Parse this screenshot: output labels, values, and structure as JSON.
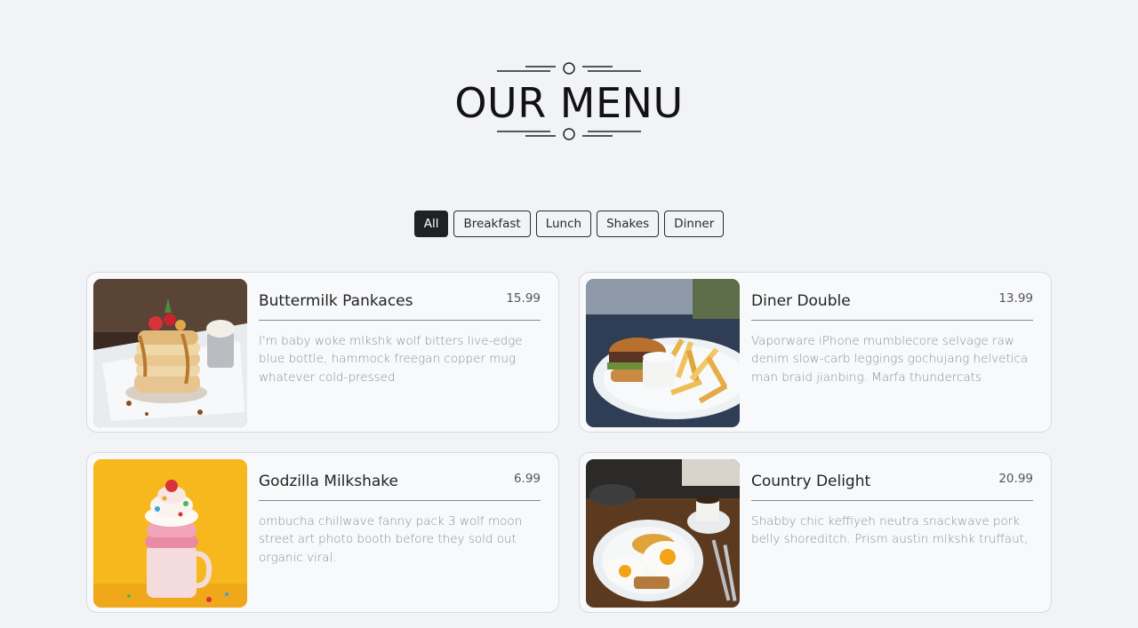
{
  "header": {
    "title": "OUR MENU"
  },
  "filters": {
    "items": [
      {
        "label": "All",
        "active": true
      },
      {
        "label": "Breakfast",
        "active": false
      },
      {
        "label": "Lunch",
        "active": false
      },
      {
        "label": "Shakes",
        "active": false
      },
      {
        "label": "Dinner",
        "active": false
      }
    ]
  },
  "menu": {
    "items": [
      {
        "title": "Buttermilk Pankaces",
        "price": "15.99",
        "description": "I'm baby woke mlkshk wolf bitters live-edge blue bottle, hammock freegan copper mug whatever cold-pressed",
        "image": "pancake-stack-photo"
      },
      {
        "title": "Diner Double",
        "price": "13.99",
        "description": "Vaporware iPhone mumblecore selvage raw denim slow-carb leggings gochujang helvetica man braid jianbing. Marfa thundercats",
        "image": "burger-and-fries-photo"
      },
      {
        "title": "Godzilla Milkshake",
        "price": "6.99",
        "description": "ombucha chillwave fanny pack 3 wolf moon street art photo booth before they sold out organic viral.",
        "image": "milkshake-photo"
      },
      {
        "title": "Country Delight",
        "price": "20.99",
        "description": "Shabby chic keffiyeh neutra snackwave pork belly shoreditch. Prism austin mlkshk truffaut,",
        "image": "eggs-breakfast-photo"
      }
    ]
  }
}
